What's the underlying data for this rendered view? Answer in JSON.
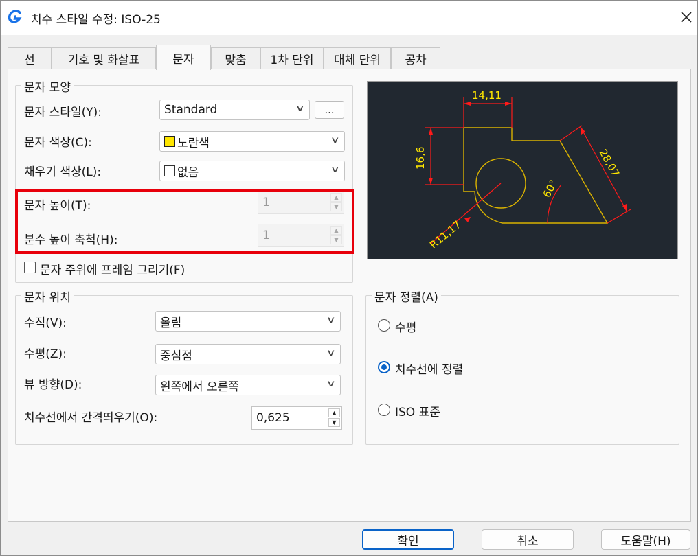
{
  "title": "치수 스타일 수정: ISO-25",
  "tabs": [
    "선",
    "기호 및 화살표",
    "문자",
    "맞춤",
    "1차 단위",
    "대체 단위",
    "공차"
  ],
  "text_appearance": {
    "group_title": "문자 모양",
    "style_label": "문자 스타일(Y):",
    "style_value": "Standard",
    "browse_label": "...",
    "color_label": "문자 색상(C):",
    "color_value": "노란색",
    "color_swatch": "#ffe600",
    "fill_label": "채우기 색상(L):",
    "fill_value": "없음",
    "height_label": "문자 높이(T):",
    "height_value": "1",
    "fraction_label": "분수 높이 축척(H):",
    "fraction_value": "1",
    "frame_label": "문자 주위에 프레임 그리기(F)"
  },
  "text_placement": {
    "group_title": "문자 위치",
    "vertical_label": "수직(V):",
    "vertical_value": "올림",
    "horizontal_label": "수평(Z):",
    "horizontal_value": "중심점",
    "view_label": "뷰 방향(D):",
    "view_value": "왼쪽에서 오른쪽",
    "offset_label": "치수선에서 간격띄우기(O):",
    "offset_value": "0,625"
  },
  "text_alignment": {
    "group_title": "문자 정렬(A)",
    "options": [
      "수평",
      "치수선에 정렬",
      "ISO 표준"
    ],
    "selected_index": 1
  },
  "preview": {
    "dim_top": "14,11",
    "dim_left": "16,6",
    "dim_diag": "28,07",
    "dim_angle": "60°",
    "dim_radius": "R11,17",
    "text_color": "#ffe600",
    "dim_color": "#ff1a1a",
    "geometry_color": "#d9b200"
  },
  "buttons": {
    "ok": "확인",
    "cancel": "취소",
    "help": "도움말(H)"
  },
  "colors": {
    "highlight": "#e8000b",
    "accent": "#0a63c8"
  }
}
